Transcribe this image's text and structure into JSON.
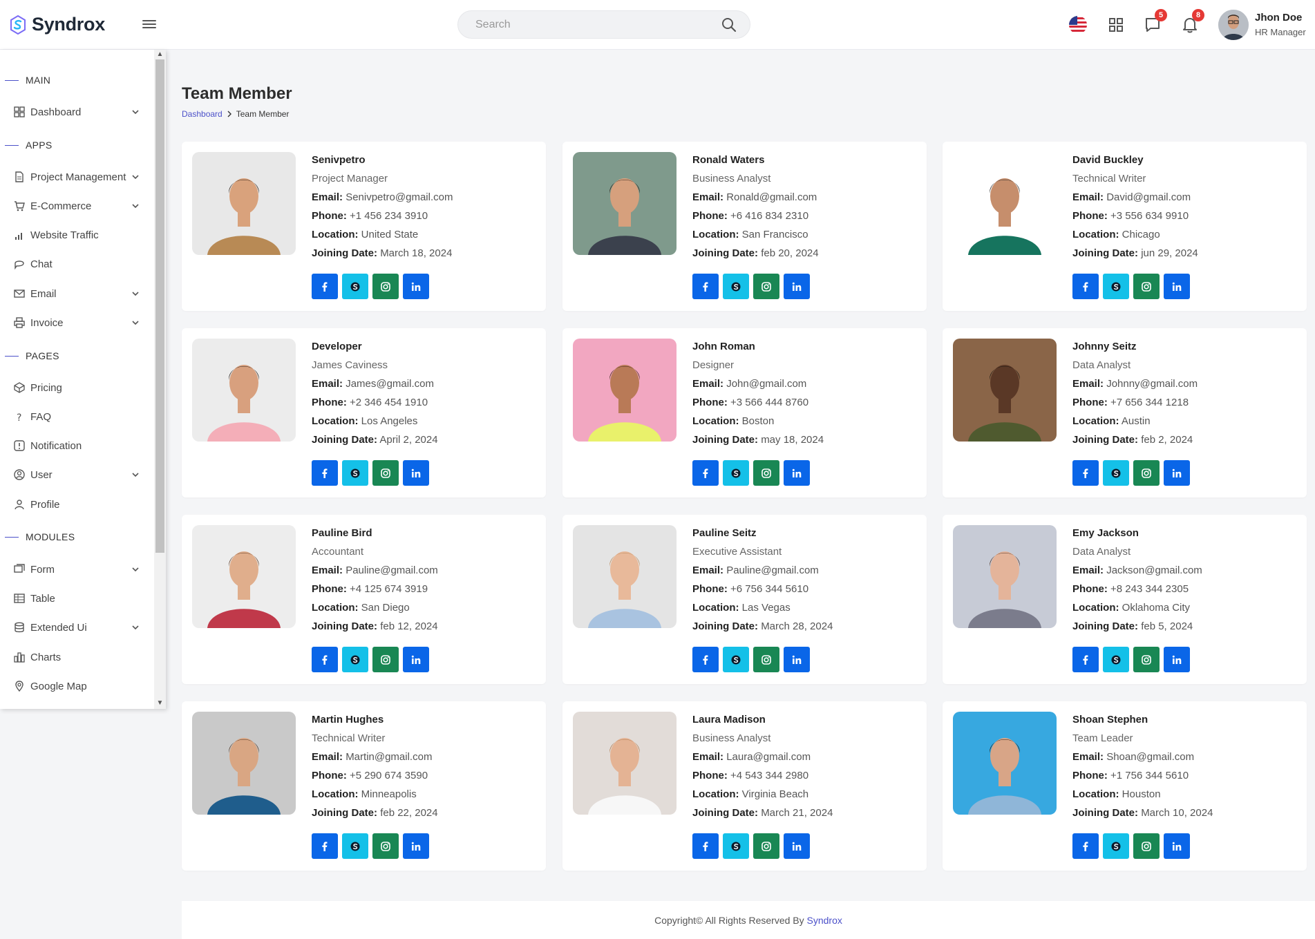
{
  "app": {
    "logo_text": "Syndrox"
  },
  "header": {
    "search_placeholder": "Search",
    "messages_count": "5",
    "notifications_count": "8",
    "user_name": "Jhon Doe",
    "user_role": "HR Manager"
  },
  "sidebar": {
    "sections": {
      "main": "MAIN",
      "apps": "APPS",
      "pages": "PAGES",
      "modules": "MODULES"
    },
    "items": {
      "dashboard": "Dashboard",
      "project_management": "Project Management",
      "ecommerce": "E-Commerce",
      "website_traffic": "Website Traffic",
      "chat": "Chat",
      "email": "Email",
      "invoice": "Invoice",
      "pricing": "Pricing",
      "faq": "FAQ",
      "notification": "Notification",
      "user": "User",
      "profile": "Profile",
      "form": "Form",
      "table": "Table",
      "extended_ui": "Extended Ui",
      "charts": "Charts",
      "google_map": "Google Map"
    }
  },
  "page": {
    "title": "Team Member",
    "breadcrumb_home": "Dashboard",
    "breadcrumb_current": "Team Member"
  },
  "labels": {
    "email": "Email:",
    "phone": "Phone:",
    "location": "Location:",
    "joining": "Joining Date:"
  },
  "members": [
    {
      "name": "Senivpetro",
      "role": "Project Manager",
      "email": "Senivpetro@gmail.com",
      "phone": "+1 456 234 3910",
      "location": "United State",
      "joining": "March 18, 2024",
      "bg": "#e8e8e8",
      "shirt": "#b88a55",
      "skin": "#d9a27c",
      "hair": "#2b1d14"
    },
    {
      "name": "Ronald Waters",
      "role": "Business Analyst",
      "email": "Ronald@gmail.com",
      "phone": "+6 416 834 2310",
      "location": "San Francisco",
      "joining": "feb 20, 2024",
      "bg": "#7f9a8c",
      "shirt": "#3b414d",
      "skin": "#d6a07d",
      "hair": "#2e2119"
    },
    {
      "name": "David Buckley",
      "role": "Technical Writer",
      "email": "David@gmail.com",
      "phone": "+3 556 634 9910",
      "location": "Chicago",
      "joining": "jun 29, 2024",
      "bg": "#ffffff",
      "shirt": "#16745e",
      "skin": "#c68e6c",
      "hair": "#2a2a2a"
    },
    {
      "name": "Developer",
      "role": "James Caviness",
      "email": "James@gmail.com",
      "phone": "+2 346 454 1910",
      "location": "Los Angeles",
      "joining": "April 2, 2024",
      "bg": "#ececec",
      "shirt": "#f4aeb8",
      "skin": "#d8a07e",
      "hair": "#2b2019"
    },
    {
      "name": "John Roman",
      "role": "Designer",
      "email": "John@gmail.com",
      "phone": "+3 566 444 8760",
      "location": "Boston",
      "joining": "may 18, 2024",
      "bg": "#f2a7c1",
      "shirt": "#e9f16b",
      "skin": "#b97a57",
      "hair": "#3d2418"
    },
    {
      "name": "Johnny Seitz",
      "role": "Data Analyst",
      "email": "Johnny@gmail.com",
      "phone": "+7 656 344 1218",
      "location": "Austin",
      "joining": "feb 2, 2024",
      "bg": "#8a6548",
      "shirt": "#4f5a2f",
      "skin": "#5a3826",
      "hair": "#1b1511"
    },
    {
      "name": "Pauline Bird",
      "role": "Accountant",
      "email": "Pauline@gmail.com",
      "phone": "+4 125 674 3919",
      "location": "San Diego",
      "joining": "feb 12, 2024",
      "bg": "#ededed",
      "shirt": "#c0394a",
      "skin": "#e0ae8c",
      "hair": "#5a3720"
    },
    {
      "name": "Pauline Seitz",
      "role": "Executive Assistant",
      "email": "Pauline@gmail.com",
      "phone": "+6 756 344 5610",
      "location": "Las Vegas",
      "joining": "March 28, 2024",
      "bg": "#e4e4e4",
      "shirt": "#a9c3e0",
      "skin": "#e8b99a",
      "hair": "#b98a5b"
    },
    {
      "name": "Emy Jackson",
      "role": "Data Analyst",
      "email": "Jackson@gmail.com",
      "phone": "+8 243 344 2305",
      "location": "Oklahoma City",
      "joining": "feb 5, 2024",
      "bg": "#c7cbd6",
      "shirt": "#7b7c8c",
      "skin": "#e4b49a",
      "hair": "#4a2d22"
    },
    {
      "name": "Martin Hughes",
      "role": "Technical Writer",
      "email": "Martin@gmail.com",
      "phone": "+5 290 674 3590",
      "location": "Minneapolis",
      "joining": "feb 22, 2024",
      "bg": "#c9c9c9",
      "shirt": "#1f5d8c",
      "skin": "#d9a683",
      "hair": "#4d3322"
    },
    {
      "name": "Laura Madison",
      "role": "Business Analyst",
      "email": "Laura@gmail.com",
      "phone": "+4 543 344 2980",
      "location": "Virginia Beach",
      "joining": "March 21, 2024",
      "bg": "#e2dcd8",
      "shirt": "#f7f7f7",
      "skin": "#e4b394",
      "hair": "#b07b4e"
    },
    {
      "name": "Shoan Stephen",
      "role": "Team Leader",
      "email": "Shoan@gmail.com",
      "phone": "+1 756 344 5610",
      "location": "Houston",
      "joining": "March 10, 2024",
      "bg": "#37a8e0",
      "shirt": "#8fb6d8",
      "skin": "#d8a587",
      "hair": "#2a1e16"
    }
  ],
  "footer": {
    "text": "Copyright© All Rights Reserved By ",
    "brand": "Syndrox"
  },
  "colors": {
    "accent": "#4b50c9",
    "facebook": "#0a66e8",
    "skype": "#14c0e8",
    "instagram": "#198754",
    "linkedin": "#0a66e8"
  }
}
